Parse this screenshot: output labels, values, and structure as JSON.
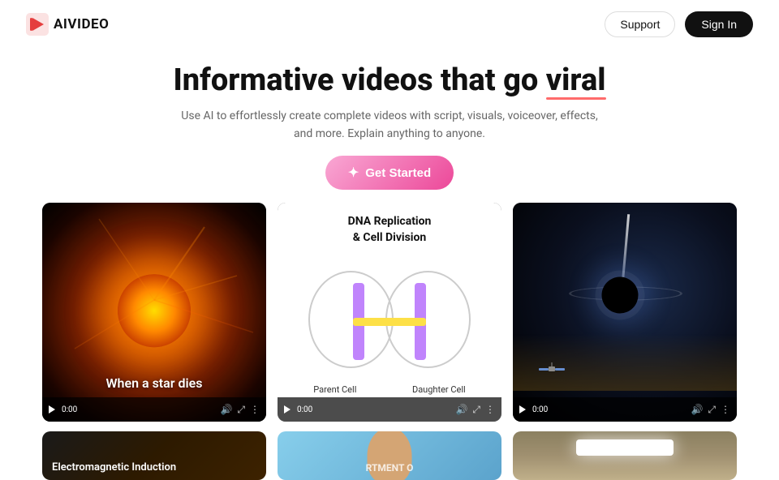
{
  "nav": {
    "logo_text": "AIVIDEO",
    "support_label": "Support",
    "signin_label": "Sign In"
  },
  "hero": {
    "title_part1": "Informative videos that go ",
    "title_viral": "viral",
    "subtitle_line1": "Use AI to effortlessly create complete videos with script, visuals, voiceover, effects,",
    "subtitle_line2": "and more. Explain anything to anyone.",
    "cta_label": "Get Started"
  },
  "videos": {
    "row1": [
      {
        "label": "When a star dies",
        "time": "0:00",
        "type": "star"
      },
      {
        "title_line1": "DNA Replication",
        "title_line2": "& Cell Division",
        "label_left": "Parent Cell",
        "label_right": "Daughter Cell",
        "time": "0:00",
        "type": "dna"
      },
      {
        "time": "0:00",
        "type": "blackhole"
      }
    ],
    "row2": [
      {
        "label": "Electromagnetic Induction",
        "type": "em"
      },
      {
        "dept_text": "RTMENT O",
        "type": "person"
      },
      {
        "type": "ceiling"
      }
    ]
  },
  "colors": {
    "accent_pink": "#ec4899",
    "underline_red": "#ff6b6b",
    "logo_accent": "#e53e3e"
  }
}
